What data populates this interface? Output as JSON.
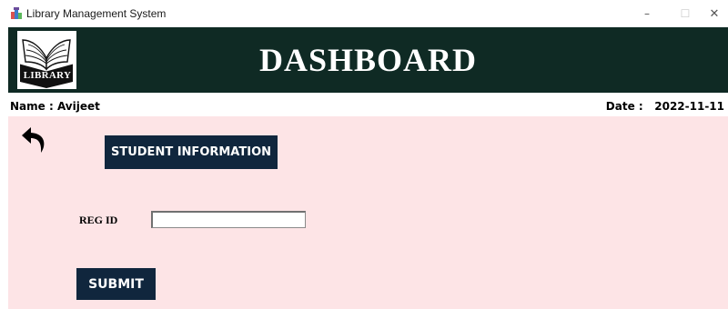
{
  "window": {
    "title": "Library Management System",
    "controls": {
      "minimize": "–",
      "maximize": "☐",
      "close": "✕"
    }
  },
  "header": {
    "logo_icon": "library-book-logo",
    "logo_text": "LIBRARY",
    "title": "DASHBOARD"
  },
  "user_info": {
    "name_label": "Name :  Avijeet",
    "date_label": "Date :   2022-11-11"
  },
  "form": {
    "back_icon": "back-arrow-icon",
    "student_info_button": "STUDENT INFORMATION",
    "reg_id_label": "REG ID",
    "reg_id_value": "",
    "submit_button": "SUBMIT"
  },
  "colors": {
    "header_bg": "#0f2a24",
    "content_bg": "#fde4e6",
    "button_bg": "#10263d",
    "button_text": "#ffffff"
  }
}
